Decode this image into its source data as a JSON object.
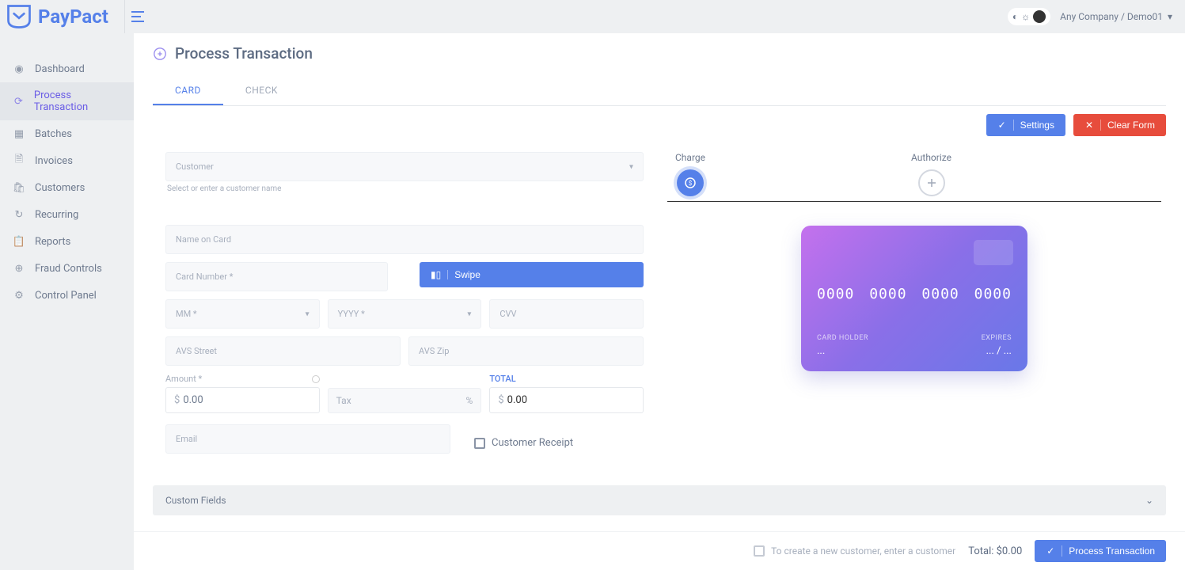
{
  "brand": "PayPact",
  "header": {
    "company": "Any Company / Demo01"
  },
  "sidebar": {
    "items": [
      {
        "label": "Dashboard",
        "icon": "dashboard"
      },
      {
        "label": "Process Transaction",
        "icon": "transaction",
        "active": true
      },
      {
        "label": "Batches",
        "icon": "batches"
      },
      {
        "label": "Invoices",
        "icon": "invoices"
      },
      {
        "label": "Customers",
        "icon": "customers"
      },
      {
        "label": "Recurring",
        "icon": "recurring"
      },
      {
        "label": "Reports",
        "icon": "reports"
      },
      {
        "label": "Fraud Controls",
        "icon": "fraud"
      },
      {
        "label": "Control Panel",
        "icon": "settings"
      }
    ]
  },
  "page": {
    "title": "Process Transaction",
    "tabs": {
      "card": "CARD",
      "check": "CHECK"
    },
    "actions": {
      "settings": "Settings",
      "clear": "Clear Form"
    },
    "options": {
      "charge": "Charge",
      "authorize": "Authorize"
    },
    "fields": {
      "customer": "Customer",
      "customer_helper": "Select or enter a customer name",
      "name_on_card": "Name on Card",
      "card_number": "Card Number *",
      "swipe": "Swipe",
      "mm": "MM *",
      "yyyy": "YYYY *",
      "cvv": "CVV",
      "avs_street": "AVS Street",
      "avs_zip": "AVS Zip",
      "amount_label": "Amount *",
      "amount_value": "0.00",
      "tax": "Tax",
      "percent": "%",
      "total_label": "TOTAL",
      "total_value": "0.00",
      "email": "Email",
      "customer_receipt": "Customer Receipt"
    },
    "card_visual": {
      "n1": "0000",
      "n2": "0000",
      "n3": "0000",
      "n4": "0000",
      "holder_label": "CARD HOLDER",
      "holder_value": "...",
      "exp_label": "EXPIRES",
      "exp_value": "... / ..."
    },
    "custom_fields": "Custom Fields",
    "footer": {
      "new_customer_hint": "To create a new customer, enter a customer",
      "total_label": "Total: $0.00",
      "submit": "Process Transaction"
    }
  }
}
